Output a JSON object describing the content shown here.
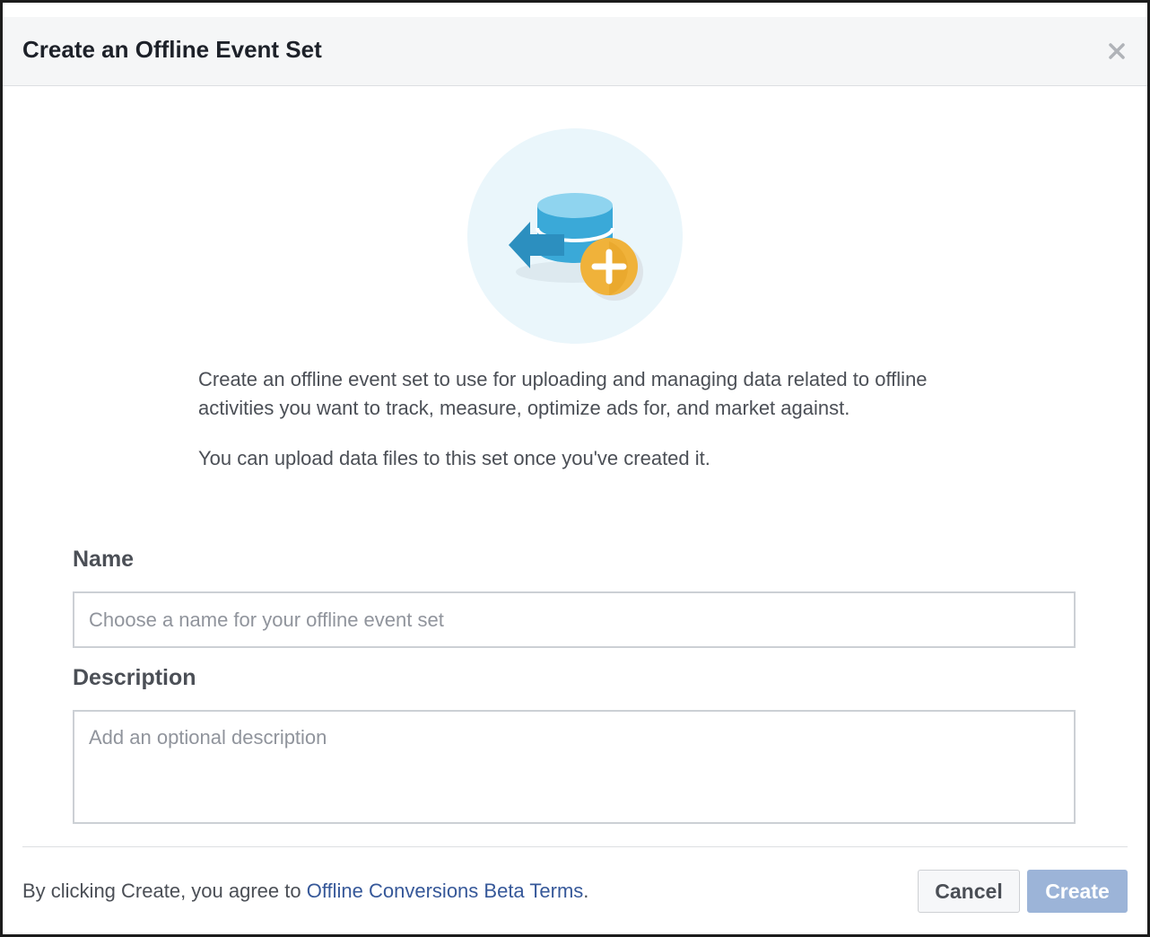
{
  "dialog": {
    "title": "Create an Offline Event Set",
    "close_icon": "close-icon"
  },
  "illustration": {
    "icon": "database-upload-plus-icon",
    "colors": {
      "circle": "#eaf6fb",
      "database": "#3aa9d8",
      "plus_badge": "#f0b23a"
    }
  },
  "description": {
    "paragraph1": "Create an offline event set to use for uploading and managing data related to offline activities you want to track, measure, optimize ads for, and market against.",
    "paragraph2": "You can upload data files to this set once you've created it."
  },
  "form": {
    "name_label": "Name",
    "name_placeholder": "Choose a name for your offline event set",
    "description_label": "Description",
    "description_placeholder": "Add an optional description"
  },
  "footer": {
    "terms_prefix": "By clicking Create, you agree to ",
    "terms_link": "Offline Conversions Beta Terms",
    "terms_suffix": ".",
    "cancel_label": "Cancel",
    "create_label": "Create",
    "colors": {
      "link": "#365899",
      "create_button": "#9cb4d8"
    }
  }
}
